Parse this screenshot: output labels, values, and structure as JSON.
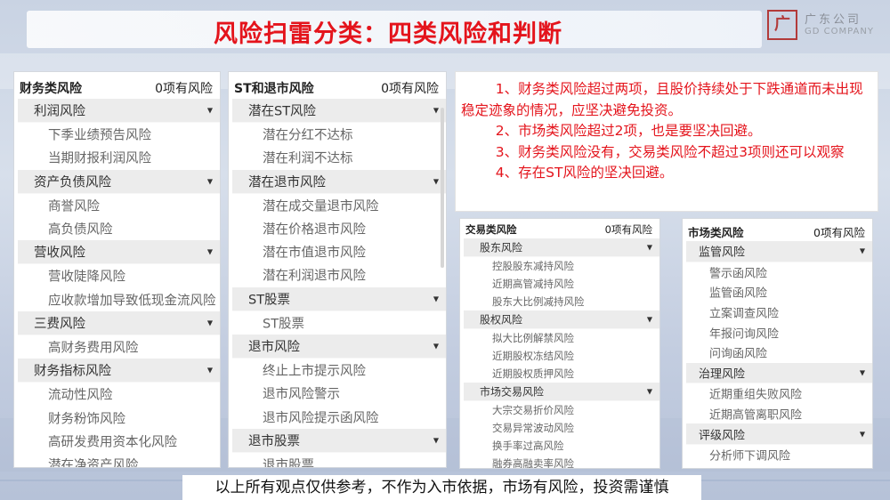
{
  "title": "风险扫雷分类：四类风险和判断",
  "logo": {
    "mark": "广",
    "cn": "广东公司",
    "en": "GD COMPANY"
  },
  "panels": {
    "financial": {
      "name": "财务类风险",
      "count": "0项有风险",
      "groups": [
        {
          "label": "利润风险",
          "items": [
            "下季业绩预告风险",
            "当期财报利润风险"
          ]
        },
        {
          "label": "资产负债风险",
          "items": [
            "商誉风险",
            "高负债风险"
          ]
        },
        {
          "label": "营收风险",
          "items": [
            "营收陡降风险",
            "应收款增加导致低现金流风险"
          ]
        },
        {
          "label": "三费风险",
          "items": [
            "高财务费用风险"
          ]
        },
        {
          "label": "财务指标风险",
          "items": [
            "流动性风险",
            "财务粉饰风险",
            "高研发费用资本化风险",
            "潜在净资产风险"
          ]
        }
      ]
    },
    "st": {
      "name": "ST和退市风险",
      "count": "0项有风险",
      "groups": [
        {
          "label": "潜在ST风险",
          "items": [
            "潜在分红不达标",
            "潜在利润不达标"
          ]
        },
        {
          "label": "潜在退市风险",
          "items": [
            "潜在成交量退市风险",
            "潜在价格退市风险",
            "潜在市值退市风险",
            "潜在利润退市风险"
          ]
        },
        {
          "label": "ST股票",
          "items": [
            "ST股票"
          ]
        },
        {
          "label": "退市风险",
          "items": [
            "终止上市提示风险",
            "退市风险警示",
            "退市风险提示函风险"
          ]
        },
        {
          "label": "退市股票",
          "items": [
            "退市股票"
          ]
        }
      ]
    },
    "trading": {
      "name": "交易类风险",
      "count": "0项有风险",
      "groups": [
        {
          "label": "股东风险",
          "items": [
            "控股股东减持风险",
            "近期高管减持风险",
            "股东大比例减持风险"
          ]
        },
        {
          "label": "股权风险",
          "items": [
            "拟大比例解禁风险",
            "近期股权冻结风险",
            "近期股权质押风险"
          ]
        },
        {
          "label": "市场交易风险",
          "items": [
            "大宗交易折价风险",
            "交易异常波动风险",
            "换手率过高风险",
            "融券高融卖率风险"
          ]
        }
      ]
    },
    "market": {
      "name": "市场类风险",
      "count": "0项有风险",
      "groups": [
        {
          "label": "监管风险",
          "items": [
            "警示函风险",
            "监管函风险",
            "立案调查风险",
            "年报问询风险",
            "问询函风险"
          ]
        },
        {
          "label": "治理风险",
          "items": [
            "近期重组失败风险",
            "近期高管离职风险"
          ]
        },
        {
          "label": "评级风险",
          "items": [
            "分析师下调风险"
          ]
        }
      ]
    }
  },
  "notes": [
    "1、财务类风险超过两项，且股价持续处于下跌通道而未出现稳定迹象的情况，应坚决避免投资。",
    "2、市场类风险超过2项，也是要坚决回避。",
    "3、财务类风险没有，交易类风险不超过3项则还可以观察",
    "4、存在ST风险的坚决回避。"
  ],
  "disclaimer": "以上所有观点仅供参考，不作为入市依据，市场有风险，投资需谨慎",
  "colors": {
    "title": "#e4141c",
    "notes": "#e4141c",
    "group_bg": "#ececec"
  },
  "icons": {
    "group_toggle": "chevron-down-icon",
    "logo": "company-seal-icon"
  }
}
